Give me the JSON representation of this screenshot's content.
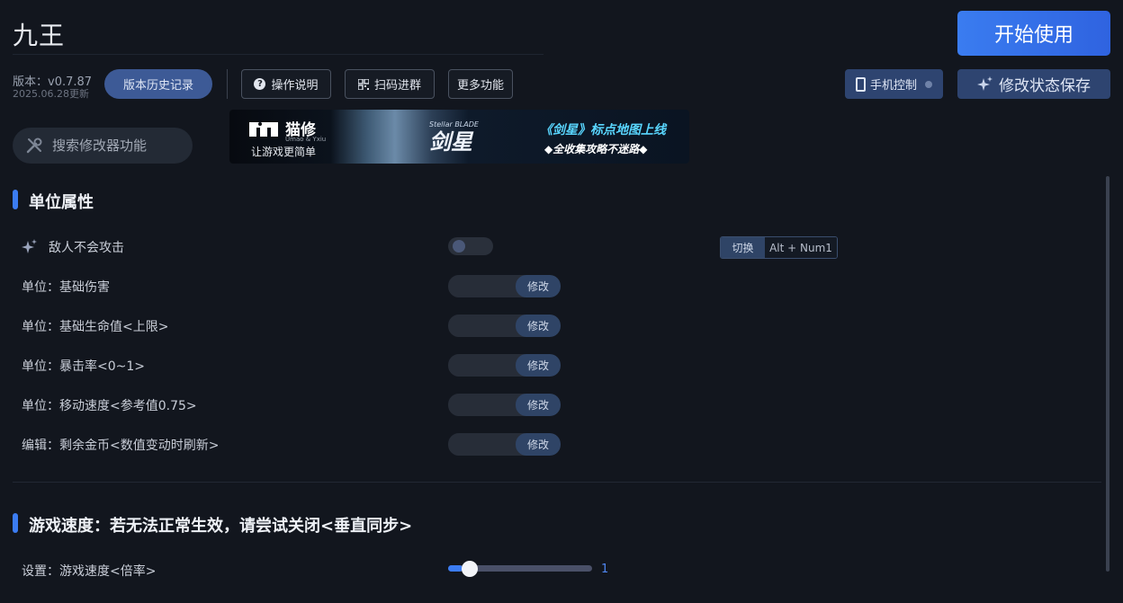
{
  "header": {
    "title": "九王",
    "version": "版本：v0.7.87",
    "update_date": "2025.06.28更新",
    "history_button": "版本历史记录",
    "manual_button": "操作说明",
    "qr_button": "扫码进群",
    "more_button": "更多功能",
    "start_button": "开始使用",
    "phone_button": "手机控制",
    "save_button": "修改状态保存"
  },
  "search": {
    "placeholder": "搜索修改器功能"
  },
  "banner": {
    "brand": "猫修",
    "brand_sub": "Umao & Yxiu",
    "tagline": "让游戏更简单",
    "game_logo": "剑星",
    "game_logo_sub": "Stellar BLADE",
    "headline": "《剑星》标点地图上线",
    "subline": "◆全收集攻略不迷路◆"
  },
  "sections": [
    {
      "title": "单位属性",
      "rows": [
        {
          "label": "敌人不会攻击",
          "type": "toggle",
          "state": "off",
          "hotkey_label": "切换",
          "hotkey": "Alt + Num1"
        },
        {
          "label": "单位：基础伤害",
          "type": "modify",
          "button": "修改"
        },
        {
          "label": "单位：基础生命值<上限>",
          "type": "modify",
          "button": "修改"
        },
        {
          "label": "单位：暴击率<0~1>",
          "type": "modify",
          "button": "修改"
        },
        {
          "label": "单位：移动速度<参考值0.75>",
          "type": "modify",
          "button": "修改"
        },
        {
          "label": "编辑：剩余金币<数值变动时刷新>",
          "type": "modify",
          "button": "修改"
        }
      ]
    },
    {
      "title": "游戏速度：若无法正常生效，请尝试关闭<垂直同步>",
      "rows": [
        {
          "label": "设置：游戏速度<倍率>",
          "type": "slider",
          "value": "1",
          "fill_fraction": 0.1
        }
      ]
    }
  ],
  "colors": {
    "background": "#12161e",
    "accent": "#3b7cf2",
    "button_dark_blue": "#2e4470"
  },
  "icons": {
    "sparkle": "sparkle-icon",
    "search": "tools-icon",
    "help": "help-icon",
    "qr": "qr-code-icon",
    "phone": "phone-icon"
  }
}
